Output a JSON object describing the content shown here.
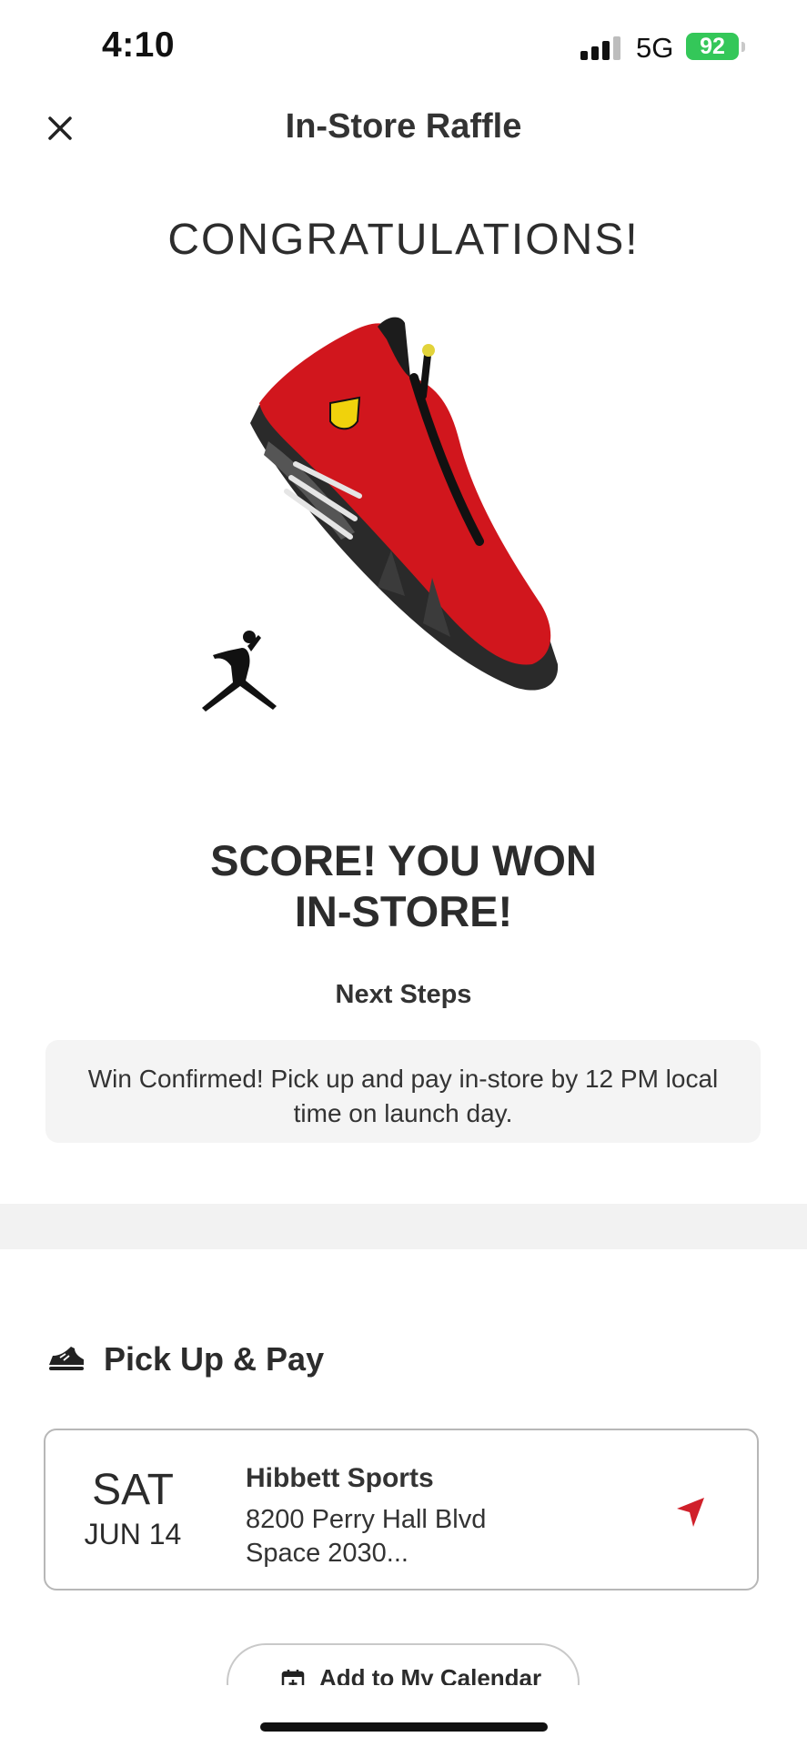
{
  "status_bar": {
    "time": "4:10",
    "network": "5G",
    "battery": "92"
  },
  "header": {
    "title": "In-Store Raffle"
  },
  "hero": {
    "congrats": "CONGRATULATIONS!",
    "product_image": "red-jordan-sneaker",
    "brand_logo": "jumpman-logo"
  },
  "result": {
    "headline_line1": "SCORE! YOU WON",
    "headline_line2": "IN-STORE!",
    "next_steps_label": "Next Steps",
    "message": "Win Confirmed! Pick up and pay in-store by 12 PM local time on launch day."
  },
  "pickup": {
    "section_icon": "sneaker-icon",
    "section_title": "Pick Up & Pay",
    "day": "SAT",
    "date": "JUN 14",
    "store_name": "Hibbett Sports",
    "address_line1": "8200 Perry Hall Blvd",
    "address_line2": "Space 2030...",
    "nav_icon": "navigation-arrow-icon",
    "accent_color": "#d0202a"
  },
  "calendar": {
    "label": "Add to My Calendar",
    "icon": "calendar-plus-icon"
  }
}
